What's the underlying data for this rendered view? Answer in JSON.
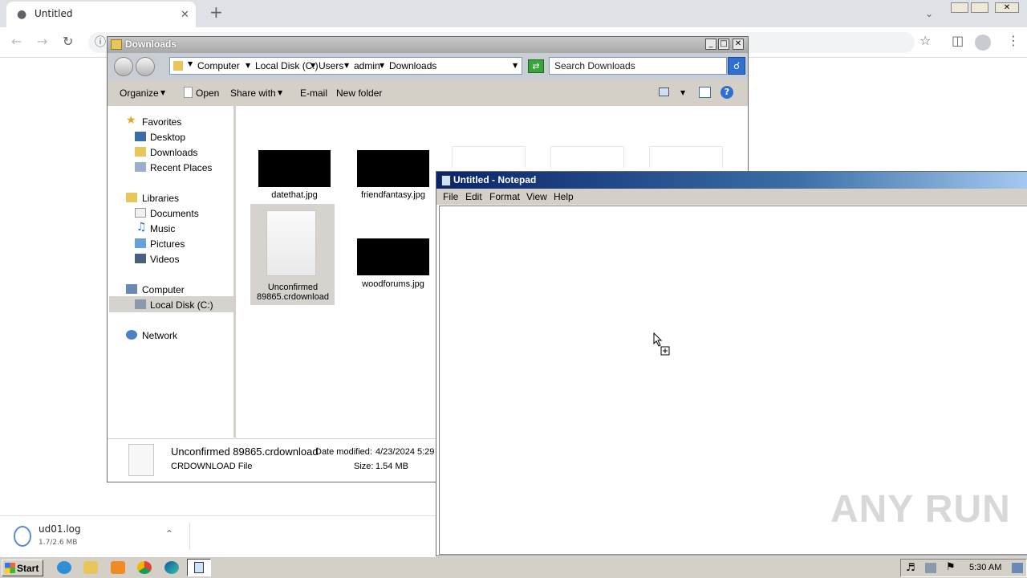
{
  "browser": {
    "tab_title": "Untitled",
    "new_tab_symbol": "+",
    "download": {
      "filename": "ud01.log",
      "progress": "1.7/2.6 MB"
    }
  },
  "explorer": {
    "title": "Downloads",
    "breadcrumb": [
      "Computer",
      "Local Disk (C:)",
      "Users",
      "admin",
      "Downloads"
    ],
    "search_placeholder": "Search Downloads",
    "toolbar": {
      "organize": "Organize",
      "open": "Open",
      "share_with": "Share with",
      "email": "E-mail",
      "new_folder": "New folder"
    },
    "nav": {
      "favorites": "Favorites",
      "desktop": "Desktop",
      "downloads": "Downloads",
      "recent_places": "Recent Places",
      "libraries": "Libraries",
      "documents": "Documents",
      "music": "Music",
      "pictures": "Pictures",
      "videos": "Videos",
      "computer": "Computer",
      "local_disk": "Local Disk (C:)",
      "network": "Network"
    },
    "files": [
      {
        "name": "datethat.jpg"
      },
      {
        "name": "friendfantasy.jpg"
      },
      {
        "name": "Unconfirmed 89865.crdownload"
      },
      {
        "name": "woodforums.jpg"
      }
    ],
    "details": {
      "name": "Unconfirmed 89865.crdownload",
      "type": "CRDOWNLOAD File",
      "date_modified_label": "Date modified:",
      "date_modified": "4/23/2024 5:29",
      "size_label": "Size:",
      "size": "1.54 MB"
    }
  },
  "notepad": {
    "title": "Untitled - Notepad",
    "menus": [
      "File",
      "Edit",
      "Format",
      "View",
      "Help"
    ]
  },
  "taskbar": {
    "start": "Start",
    "clock": "5:30 AM"
  },
  "watermark": "ANY RUN"
}
